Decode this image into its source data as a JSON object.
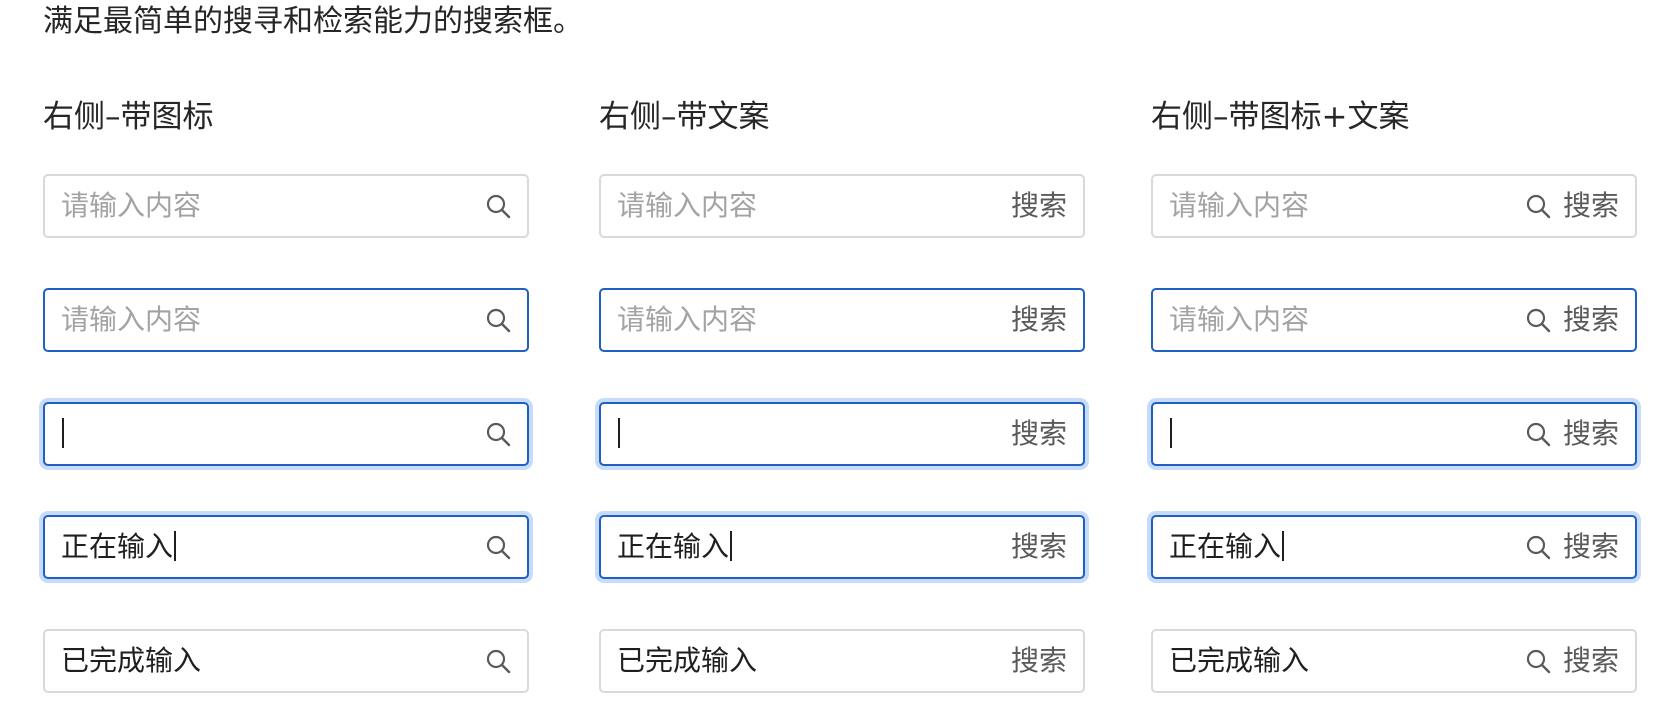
{
  "intro": "满足最简单的搜寻和检索能力的搜索框。",
  "columns": [
    {
      "title": "右侧–带图标",
      "icon": "search-icon",
      "button": null,
      "rows": [
        {
          "state": "default",
          "placeholder": "请输入内容",
          "value": ""
        },
        {
          "state": "hover",
          "placeholder": "请输入内容",
          "value": ""
        },
        {
          "state": "focus",
          "placeholder": "",
          "value": "",
          "caret": true
        },
        {
          "state": "typing",
          "placeholder": "",
          "value": "正在输入",
          "caret": true
        },
        {
          "state": "filled",
          "placeholder": "",
          "value": "已完成输入"
        }
      ]
    },
    {
      "title": "右侧–带文案",
      "icon": null,
      "button": "搜索",
      "rows": [
        {
          "state": "default",
          "placeholder": "请输入内容",
          "value": ""
        },
        {
          "state": "hover",
          "placeholder": "请输入内容",
          "value": ""
        },
        {
          "state": "focus",
          "placeholder": "",
          "value": "",
          "caret": true
        },
        {
          "state": "typing",
          "placeholder": "",
          "value": "正在输入",
          "caret": true
        },
        {
          "state": "filled",
          "placeholder": "",
          "value": "已完成输入"
        }
      ]
    },
    {
      "title": "右侧–带图标+文案",
      "icon": "search-icon",
      "button": "搜索",
      "rows": [
        {
          "state": "default",
          "placeholder": "请输入内容",
          "value": ""
        },
        {
          "state": "hover",
          "placeholder": "请输入内容",
          "value": ""
        },
        {
          "state": "focus",
          "placeholder": "",
          "value": "",
          "caret": true
        },
        {
          "state": "typing",
          "placeholder": "",
          "value": "正在输入",
          "caret": true
        },
        {
          "state": "filled",
          "placeholder": "",
          "value": "已完成输入"
        }
      ]
    }
  ],
  "colors": {
    "border_default": "#d9d9d9",
    "border_active": "#1f5fc6",
    "focus_glow": "#c7dcf8",
    "placeholder": "#a3a3a3",
    "text": "#1f1f1f",
    "action_text": "#5a5a5a"
  }
}
